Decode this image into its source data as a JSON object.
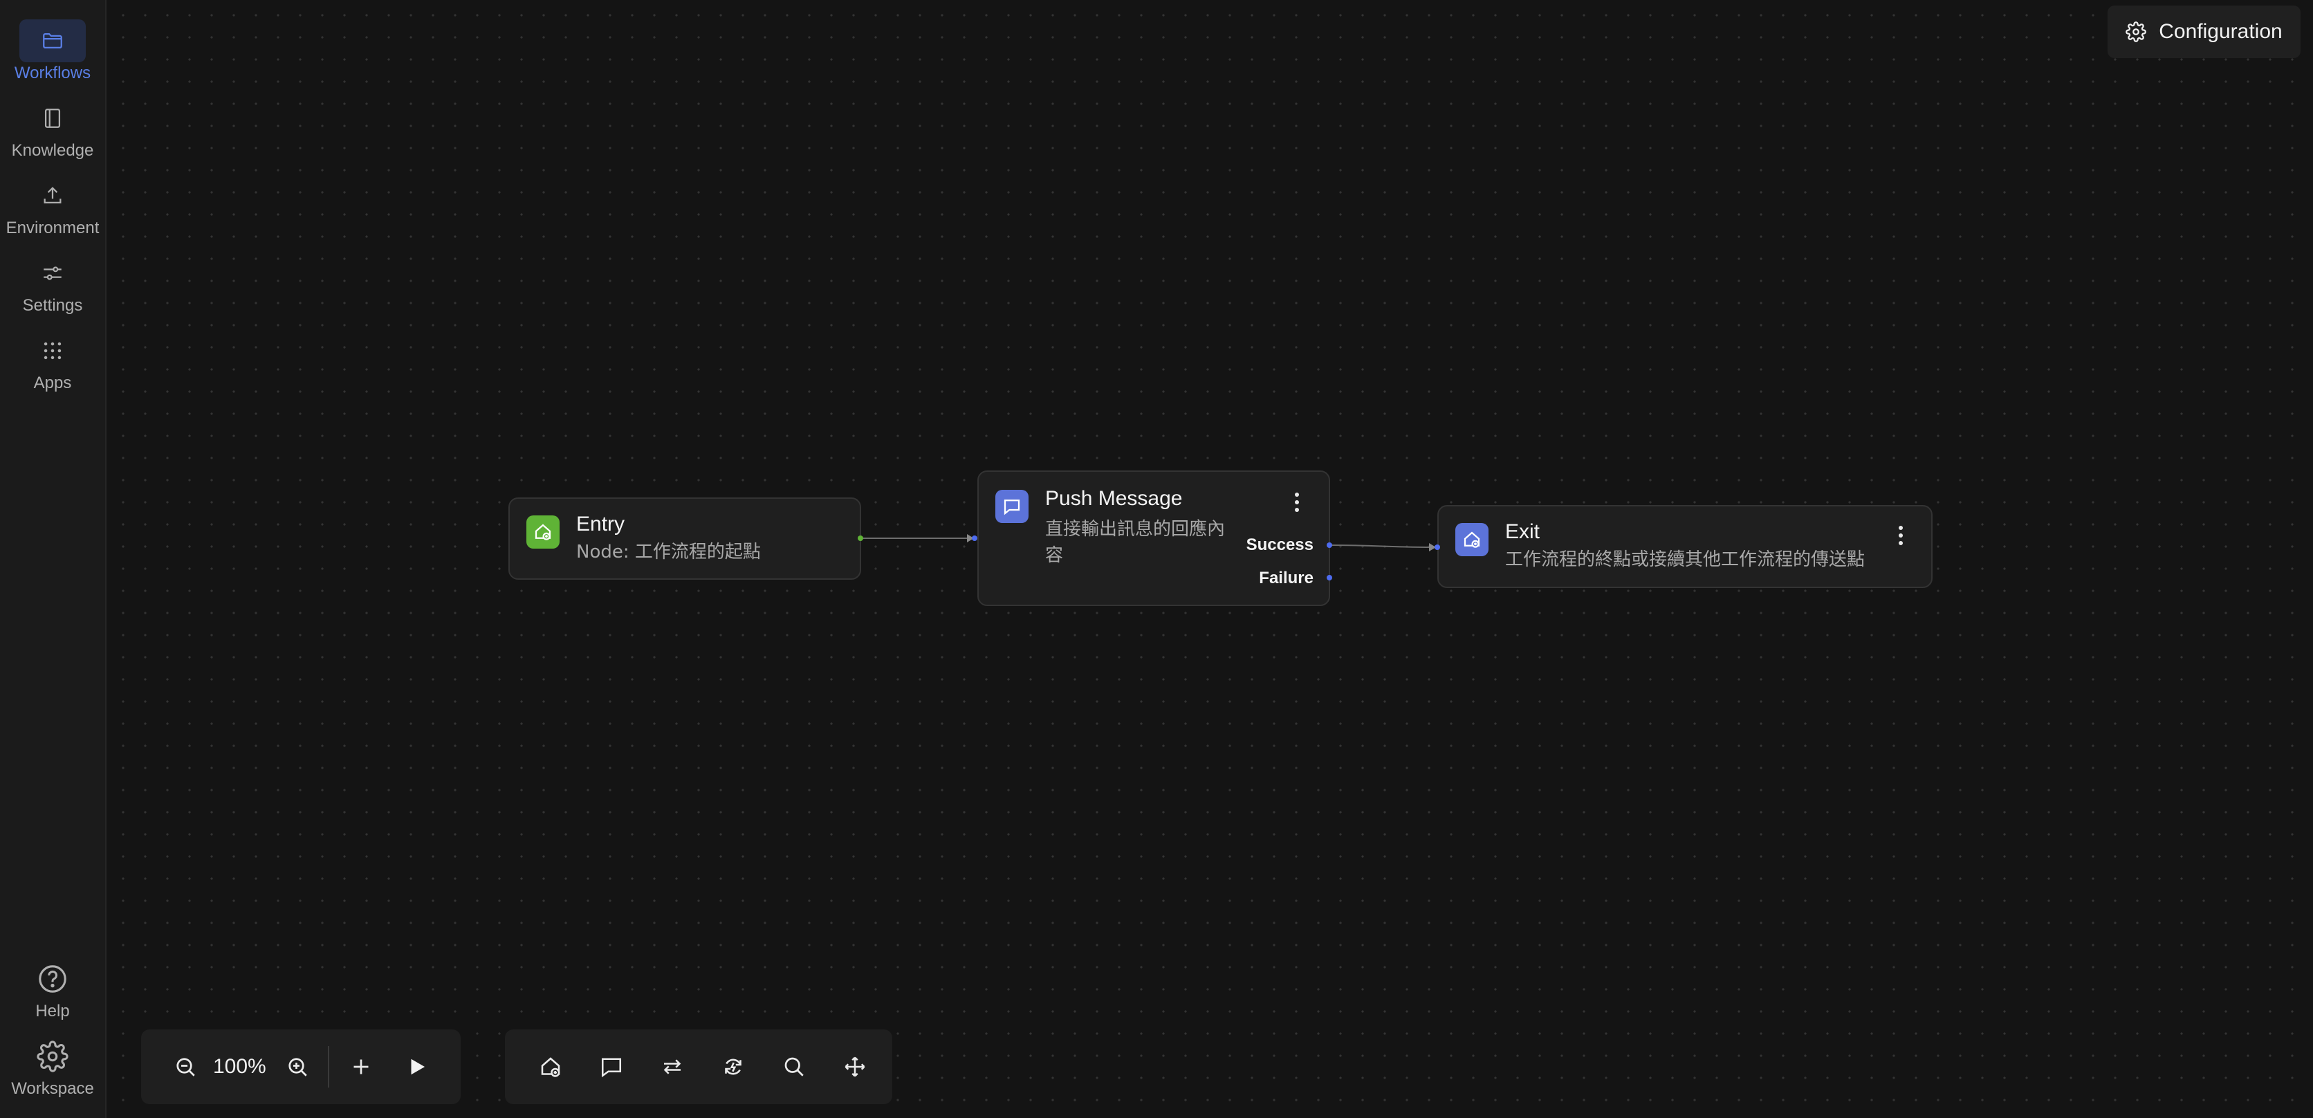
{
  "sidebar": {
    "items": [
      {
        "label": "Workflows",
        "icon": "folder-icon",
        "active": true
      },
      {
        "label": "Knowledge",
        "icon": "book-icon"
      },
      {
        "label": "Environment",
        "icon": "upload-icon"
      },
      {
        "label": "Settings",
        "icon": "sliders-icon"
      },
      {
        "label": "Apps",
        "icon": "grid-icon"
      }
    ],
    "bottom": [
      {
        "label": "Help",
        "icon": "help-circle-icon"
      },
      {
        "label": "Workspace",
        "icon": "gear-icon"
      }
    ]
  },
  "header": {
    "config_label": "Configuration"
  },
  "nodes": {
    "entry": {
      "title": "Entry",
      "desc": "Node: 工作流程的起點"
    },
    "push": {
      "title": "Push Message",
      "desc_line1": "直接輸出訊息的回應內",
      "desc_line2": "容",
      "success": "Success",
      "failure": "Failure"
    },
    "exit": {
      "title": "Exit",
      "desc": "工作流程的終點或接續其他工作流程的傳送點"
    }
  },
  "zoom_bar": {
    "zoom": "100%"
  },
  "colors": {
    "accent": "#5a7fe6",
    "entry_icon": "#5fb336",
    "node_icon": "#5c73d9",
    "port_green": "#5fb336",
    "port_blue": "#4e6cf0"
  }
}
